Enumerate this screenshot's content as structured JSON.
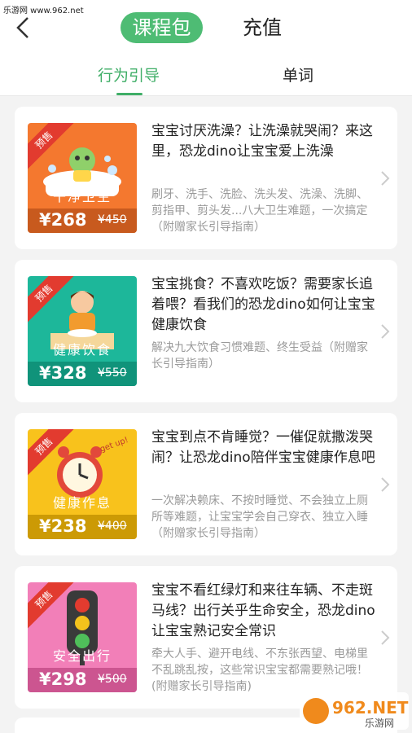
{
  "watermark_top": "乐游网 www.962.net",
  "header": {
    "tab_active": "课程包",
    "tab_other": "充值"
  },
  "subnav": {
    "active": "行为引导",
    "other": "单词"
  },
  "colors": {
    "accent": "#4ebc74",
    "tag": "#e23b2f"
  },
  "cards": [
    {
      "tag": "预售",
      "label": "干净卫生",
      "price": "¥268",
      "orig": "¥450",
      "title": "宝宝讨厌洗澡？让洗澡就哭闹？来这里，恐龙dino让宝宝爱上洗澡",
      "desc": "刷牙、洗手、洗脸、洗头发、洗澡、洗脚、剪指甲、剪头发...八大卫生难题，一次搞定（附赠家长引导指南）",
      "bg": "#f4782f",
      "bar": "#c85a1e"
    },
    {
      "tag": "预售",
      "label": "健康饮食",
      "price": "¥328",
      "orig": "¥550",
      "title": "宝宝挑食？不喜欢吃饭？需要家长追着喂？看我们的恐龙dino如何让宝宝健康饮食",
      "desc": "解决九大饮食习惯难题、终生受益（附赠家长引导指南）",
      "bg": "#1db79a",
      "bar": "#10937a"
    },
    {
      "tag": "预售",
      "label": "健康作息",
      "price": "¥238",
      "orig": "¥400",
      "title": "宝宝到点不肯睡觉？一催促就撒泼哭闹？让恐龙dino陪伴宝宝健康作息吧",
      "desc": "一次解决赖床、不按时睡觉、不会独立上厕所等难题，让宝宝学会自己穿衣、独立入睡（附赠家长引导指南）",
      "bg": "#f8c21c",
      "bar": "#cc9a05"
    },
    {
      "tag": "预售",
      "label": "安全出行",
      "price": "¥298",
      "orig": "¥500",
      "title": "宝宝不看红绿灯和来往车辆、不走斑马线？出行关乎生命安全，恐龙dino让宝宝熟记安全常识",
      "desc": "牵大人手、避开电线、不东张西望、电梯里不乱跳乱按，这些常识宝宝都需要熟记哦！(附赠家长引导指南)",
      "bg": "#f27fb8",
      "bar": "#cc5590"
    }
  ],
  "watermark_bottom": {
    "text_main": "962.NET",
    "text_sub": "乐游网"
  }
}
